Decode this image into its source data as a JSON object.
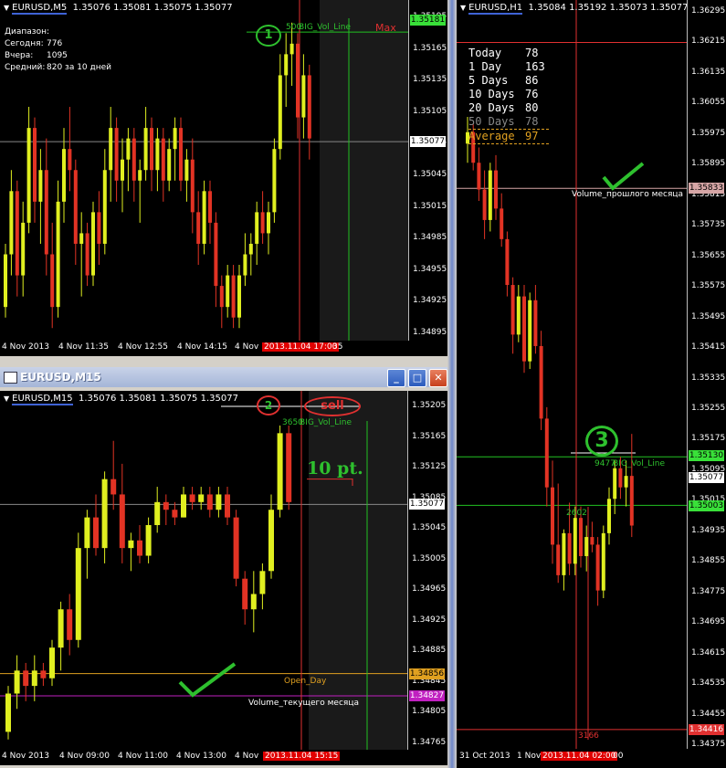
{
  "colors": {
    "bull": "#e0ef20",
    "bear": "#e23324",
    "green_line": "#22c022",
    "red_line": "#e03030",
    "pink_line": "#c020c0",
    "orange_line": "#e0a020",
    "annot_green": "#2ec02e"
  },
  "top_left": {
    "header": "EURUSD,M5",
    "ohlc": "1.35076 1.35081 1.35075 1.35077",
    "info": [
      {
        "label": "Диапазон:",
        "value": ""
      },
      {
        "label": "Сегодня:",
        "value": "776"
      },
      {
        "label": "Вчера:",
        "value": "1095"
      },
      {
        "label": "Средний:",
        "value": "820 за 10 дней"
      }
    ],
    "big_vol_label": "BIG_Vol_Line",
    "big_vol_value": "500",
    "max_label": "Max",
    "marker": "1",
    "price_ticks": [
      "1.35195",
      "1.35165",
      "1.35135",
      "1.35105",
      "1.35075",
      "1.35045",
      "1.35015",
      "1.34985",
      "1.34955",
      "1.34925",
      "1.34895"
    ],
    "price_box_top": "1.35181",
    "price_box_current": "1.35077",
    "time_labels": [
      "4 Nov 2013",
      "4 Nov 11:35",
      "4 Nov 12:55",
      "4 Nov 14:15",
      "4 Nov"
    ],
    "time_red": "2013.11.04 17:00",
    "time_tail": "35",
    "candles": [
      [
        1.3492,
        1.3498,
        1.3491,
        1.3497
      ],
      [
        1.3497,
        1.3505,
        1.3495,
        1.3503
      ],
      [
        1.3503,
        1.3504,
        1.3493,
        1.3495
      ],
      [
        1.3495,
        1.3502,
        1.3493,
        1.35
      ],
      [
        1.35,
        1.3511,
        1.3499,
        1.3509
      ],
      [
        1.3509,
        1.351,
        1.35,
        1.3502
      ],
      [
        1.3502,
        1.3507,
        1.3498,
        1.3505
      ],
      [
        1.3505,
        1.3508,
        1.3495,
        1.3497
      ],
      [
        1.3497,
        1.35,
        1.349,
        1.3492
      ],
      [
        1.3492,
        1.3504,
        1.3491,
        1.3502
      ],
      [
        1.3502,
        1.3509,
        1.35,
        1.3507
      ],
      [
        1.3507,
        1.3511,
        1.3503,
        1.3505
      ],
      [
        1.3505,
        1.3506,
        1.3496,
        1.3498
      ],
      [
        1.3498,
        1.3501,
        1.3493,
        1.3499
      ],
      [
        1.3499,
        1.35,
        1.3494,
        1.3495
      ],
      [
        1.3495,
        1.3502,
        1.3494,
        1.3501
      ],
      [
        1.3501,
        1.3503,
        1.3496,
        1.3498
      ],
      [
        1.3498,
        1.3507,
        1.3497,
        1.3505
      ],
      [
        1.3505,
        1.3511,
        1.3502,
        1.3509
      ],
      [
        1.3509,
        1.351,
        1.3502,
        1.3504
      ],
      [
        1.3504,
        1.3508,
        1.3501,
        1.3506
      ],
      [
        1.3506,
        1.3509,
        1.3503,
        1.3508
      ],
      [
        1.3508,
        1.3509,
        1.3502,
        1.3504
      ],
      [
        1.3504,
        1.3506,
        1.35,
        1.3505
      ],
      [
        1.3505,
        1.3511,
        1.3504,
        1.3509
      ],
      [
        1.3509,
        1.351,
        1.3503,
        1.3505
      ],
      [
        1.3505,
        1.3509,
        1.3503,
        1.3508
      ],
      [
        1.3508,
        1.3509,
        1.3502,
        1.3504
      ],
      [
        1.3504,
        1.3508,
        1.3503,
        1.3507
      ],
      [
        1.3507,
        1.351,
        1.3504,
        1.3509
      ],
      [
        1.3509,
        1.351,
        1.3503,
        1.3504
      ],
      [
        1.3504,
        1.3507,
        1.3502,
        1.3506
      ],
      [
        1.3506,
        1.3508,
        1.3499,
        1.3501
      ],
      [
        1.3501,
        1.3503,
        1.3496,
        1.3498
      ],
      [
        1.3498,
        1.3504,
        1.3497,
        1.3503
      ],
      [
        1.3503,
        1.3504,
        1.3498,
        1.35
      ],
      [
        1.35,
        1.3501,
        1.3492,
        1.3494
      ],
      [
        1.3494,
        1.3495,
        1.349,
        1.3492
      ],
      [
        1.3492,
        1.3496,
        1.3491,
        1.3495
      ],
      [
        1.3495,
        1.3496,
        1.349,
        1.3491
      ],
      [
        1.3491,
        1.3496,
        1.349,
        1.3495
      ],
      [
        1.3495,
        1.3499,
        1.3494,
        1.3497
      ],
      [
        1.3497,
        1.3499,
        1.3495,
        1.3498
      ],
      [
        1.3498,
        1.3502,
        1.3496,
        1.3501
      ],
      [
        1.3501,
        1.3503,
        1.3498,
        1.3499
      ],
      [
        1.3499,
        1.3502,
        1.3497,
        1.3501
      ],
      [
        1.3501,
        1.3508,
        1.35,
        1.3507
      ],
      [
        1.3507,
        1.3516,
        1.3506,
        1.3514
      ],
      [
        1.3514,
        1.3518,
        1.3511,
        1.3516
      ],
      [
        1.3516,
        1.3519,
        1.3513,
        1.3517
      ],
      [
        1.3517,
        1.3518,
        1.3508,
        1.351
      ],
      [
        1.351,
        1.3516,
        1.3508,
        1.3514
      ],
      [
        1.3514,
        1.3515,
        1.3506,
        1.3508
      ]
    ]
  },
  "bottom_left": {
    "window_title": "EURUSD,M15",
    "header": "EURUSD,M15",
    "ohlc": "1.35076 1.35081 1.35075 1.35077",
    "marker": "2",
    "sell_label": "sell",
    "big_vol_label": "BIG_Vol_Line",
    "big_vol_value": "3650",
    "ten_pt": "10 pt.",
    "open_day_label": "Open_Day",
    "volume_month_label": "Volume_текущего месяца",
    "price_ticks": [
      "1.35205",
      "1.35165",
      "1.35125",
      "1.35085",
      "1.35045",
      "1.35005",
      "1.34965",
      "1.34925",
      "1.34885",
      "1.34845",
      "1.34805",
      "1.34765"
    ],
    "price_box_current": "1.35077",
    "price_box_open": "1.34856",
    "price_box_month": "1.34827",
    "time_labels": [
      "4 Nov 2013",
      "4 Nov 09:00",
      "4 Nov 11:00",
      "4 Nov 13:00",
      "4 Nov"
    ],
    "time_red": "2013.11.04 15:15",
    "candles": [
      [
        1.3478,
        1.3484,
        1.3477,
        1.3483
      ],
      [
        1.3483,
        1.3488,
        1.3481,
        1.3486
      ],
      [
        1.3486,
        1.3487,
        1.3482,
        1.3484
      ],
      [
        1.3484,
        1.3488,
        1.3482,
        1.3486
      ],
      [
        1.3486,
        1.3487,
        1.3484,
        1.3485
      ],
      [
        1.3485,
        1.349,
        1.3484,
        1.3489
      ],
      [
        1.3489,
        1.3495,
        1.3486,
        1.3494
      ],
      [
        1.3494,
        1.3496,
        1.3488,
        1.349
      ],
      [
        1.349,
        1.3504,
        1.3489,
        1.3502
      ],
      [
        1.3502,
        1.3507,
        1.3498,
        1.3506
      ],
      [
        1.3506,
        1.3509,
        1.3501,
        1.3502
      ],
      [
        1.3502,
        1.3512,
        1.35,
        1.3511
      ],
      [
        1.3511,
        1.3516,
        1.3507,
        1.3509
      ],
      [
        1.3509,
        1.3513,
        1.35,
        1.3502
      ],
      [
        1.3502,
        1.3504,
        1.3499,
        1.3503
      ],
      [
        1.3503,
        1.3505,
        1.35,
        1.3501
      ],
      [
        1.3501,
        1.3506,
        1.35,
        1.3505
      ],
      [
        1.3505,
        1.351,
        1.3504,
        1.3508
      ],
      [
        1.3508,
        1.3509,
        1.3505,
        1.3507
      ],
      [
        1.3507,
        1.3508,
        1.3505,
        1.3506
      ],
      [
        1.3506,
        1.351,
        1.3506,
        1.3509
      ],
      [
        1.3509,
        1.351,
        1.3507,
        1.3508
      ],
      [
        1.3508,
        1.351,
        1.3507,
        1.3509
      ],
      [
        1.3509,
        1.351,
        1.3506,
        1.3507
      ],
      [
        1.3507,
        1.351,
        1.3506,
        1.3509
      ],
      [
        1.3509,
        1.351,
        1.3505,
        1.3506
      ],
      [
        1.3506,
        1.3507,
        1.3497,
        1.3498
      ],
      [
        1.3498,
        1.3499,
        1.3492,
        1.3494
      ],
      [
        1.3494,
        1.3499,
        1.3491,
        1.3496
      ],
      [
        1.3496,
        1.35,
        1.3494,
        1.3499
      ],
      [
        1.3499,
        1.3509,
        1.3498,
        1.3507
      ],
      [
        1.3507,
        1.3518,
        1.3506,
        1.3517
      ],
      [
        1.3517,
        1.3518,
        1.3507,
        1.3508
      ]
    ]
  },
  "right": {
    "header": "EURUSD,H1",
    "ohlc": "1.35084 1.35192 1.35073 1.35077",
    "stats": [
      {
        "label": "Today",
        "value": "78"
      },
      {
        "label": "1 Day",
        "value": "163"
      },
      {
        "label": "5 Days",
        "value": "86"
      },
      {
        "label": "10 Days",
        "value": "76"
      },
      {
        "label": "20 Days",
        "value": "80"
      },
      {
        "label": "50 Days",
        "value": "78"
      },
      {
        "label": "Average",
        "value": "97"
      }
    ],
    "volume_prev_label": "Volume_прошлого месяца",
    "marker": "3",
    "big_vol_label": "BIG_Vol_Line",
    "big_vol_value": "9477",
    "level_2602": "2602",
    "level_3166": "3166",
    "price_ticks": [
      "1.36295",
      "1.36215",
      "1.36135",
      "1.36055",
      "1.35975",
      "1.35895",
      "1.35815",
      "1.35735",
      "1.35655",
      "1.35575",
      "1.35495",
      "1.35415",
      "1.35335",
      "1.35255",
      "1.35175",
      "1.35095",
      "1.35015",
      "1.34935",
      "1.34855",
      "1.34775",
      "1.34695",
      "1.34615",
      "1.34535",
      "1.34455",
      "1.34375"
    ],
    "price_box_prev": "1.35833",
    "price_box_big": "1.35130",
    "price_box_current": "1.35077",
    "price_box_green": "1.35003",
    "price_box_low": "1.34416",
    "time_labels": [
      "31 Oct 2013",
      "1 Nov"
    ],
    "time_red": "2013.11.04 02:00",
    "time_tail": "00",
    "candles": [
      [
        1.3595,
        1.3602,
        1.359,
        1.3598
      ],
      [
        1.3598,
        1.36,
        1.3588,
        1.359
      ],
      [
        1.359,
        1.3594,
        1.358,
        1.3583
      ],
      [
        1.3583,
        1.3588,
        1.357,
        1.3575
      ],
      [
        1.3575,
        1.359,
        1.3572,
        1.3588
      ],
      [
        1.3588,
        1.3592,
        1.3575,
        1.3578
      ],
      [
        1.3578,
        1.3582,
        1.3568,
        1.357
      ],
      [
        1.357,
        1.3572,
        1.3555,
        1.3558
      ],
      [
        1.3558,
        1.356,
        1.354,
        1.3545
      ],
      [
        1.3545,
        1.3558,
        1.3543,
        1.3555
      ],
      [
        1.3555,
        1.3558,
        1.3535,
        1.3538
      ],
      [
        1.3538,
        1.3556,
        1.3536,
        1.3554
      ],
      [
        1.3554,
        1.3558,
        1.354,
        1.3542
      ],
      [
        1.3542,
        1.3546,
        1.352,
        1.3523
      ],
      [
        1.3523,
        1.3526,
        1.35,
        1.3505
      ],
      [
        1.3505,
        1.3512,
        1.3485,
        1.349
      ],
      [
        1.349,
        1.3506,
        1.348,
        1.3482
      ],
      [
        1.3482,
        1.3494,
        1.3478,
        1.3493
      ],
      [
        1.3493,
        1.3501,
        1.3482,
        1.3485
      ],
      [
        1.3485,
        1.35,
        1.3482,
        1.3497
      ],
      [
        1.3497,
        1.35,
        1.3484,
        1.3487
      ],
      [
        1.3487,
        1.3495,
        1.3483,
        1.3492
      ],
      [
        1.3492,
        1.3496,
        1.3488,
        1.349
      ],
      [
        1.349,
        1.3492,
        1.3474,
        1.3478
      ],
      [
        1.3478,
        1.3495,
        1.3476,
        1.3493
      ],
      [
        1.3493,
        1.3505,
        1.349,
        1.3502
      ],
      [
        1.3502,
        1.3512,
        1.3498,
        1.351
      ],
      [
        1.351,
        1.3513,
        1.3502,
        1.3505
      ],
      [
        1.3505,
        1.3512,
        1.35,
        1.3508
      ],
      [
        1.3508,
        1.3519,
        1.3492,
        1.3495
      ]
    ]
  }
}
